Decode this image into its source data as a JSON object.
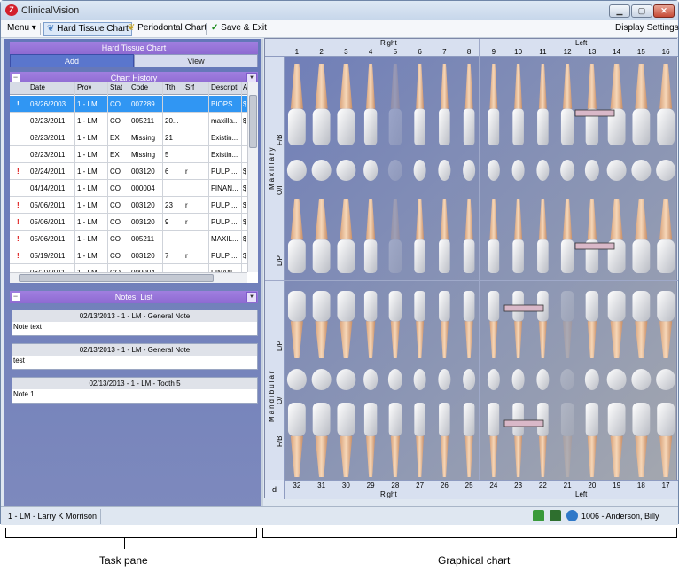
{
  "window": {
    "title": "ClinicalVision"
  },
  "toolbar": {
    "menu": "Menu",
    "hard_tissue": "Hard Tissue Chart",
    "periodontal": "Periodontal Chart",
    "save_exit": "Save & Exit",
    "display_settings": "Display Settings"
  },
  "taskpane": {
    "header": "Hard Tissue Chart",
    "add": "Add",
    "view": "View",
    "history_header": "Chart History",
    "columns": [
      "Date",
      "Prov",
      "Stat",
      "Code",
      "Tth",
      "Srf",
      "Descripti",
      "A"
    ],
    "rows": [
      {
        "flag": "!",
        "date": "08/26/2003",
        "prov": "1 - LM",
        "stat": "CO",
        "code": "007289",
        "tth": "",
        "srf": "",
        "desc": "BIOPS...",
        "a": "$"
      },
      {
        "flag": "",
        "date": "02/23/2011",
        "prov": "1 - LM",
        "stat": "CO",
        "code": "005211",
        "tth": "20...",
        "srf": "",
        "desc": "maxilla...",
        "a": "$"
      },
      {
        "flag": "",
        "date": "02/23/2011",
        "prov": "1 - LM",
        "stat": "EX",
        "code": "Missing",
        "tth": "21",
        "srf": "",
        "desc": "Existin...",
        "a": ""
      },
      {
        "flag": "",
        "date": "02/23/2011",
        "prov": "1 - LM",
        "stat": "EX",
        "code": "Missing",
        "tth": "5",
        "srf": "",
        "desc": "Existin...",
        "a": ""
      },
      {
        "flag": "!",
        "date": "02/24/2011",
        "prov": "1 - LM",
        "stat": "CO",
        "code": "003120",
        "tth": "6",
        "srf": "r",
        "desc": "PULP ...",
        "a": "$"
      },
      {
        "flag": "",
        "date": "04/14/2011",
        "prov": "1 - LM",
        "stat": "CO",
        "code": "000004",
        "tth": "",
        "srf": "",
        "desc": "FINAN...",
        "a": "$"
      },
      {
        "flag": "!",
        "date": "05/06/2011",
        "prov": "1 - LM",
        "stat": "CO",
        "code": "003120",
        "tth": "23",
        "srf": "r",
        "desc": "PULP ...",
        "a": "$"
      },
      {
        "flag": "!",
        "date": "05/06/2011",
        "prov": "1 - LM",
        "stat": "CO",
        "code": "003120",
        "tth": "9",
        "srf": "r",
        "desc": "PULP ...",
        "a": "$"
      },
      {
        "flag": "!",
        "date": "05/06/2011",
        "prov": "1 - LM",
        "stat": "CO",
        "code": "005211",
        "tth": "",
        "srf": "",
        "desc": "MAXIL...",
        "a": "$"
      },
      {
        "flag": "!",
        "date": "05/19/2011",
        "prov": "1 - LM",
        "stat": "CO",
        "code": "003120",
        "tth": "7",
        "srf": "r",
        "desc": "PULP ...",
        "a": "$"
      },
      {
        "flag": "",
        "date": "06/20/2011",
        "prov": "1 - LM",
        "stat": "CO",
        "code": "000004",
        "tth": "",
        "srf": "",
        "desc": "FINAN...",
        "a": ""
      }
    ],
    "notes_header": "Notes: List",
    "notes": [
      {
        "title": "02/13/2013 - 1 - LM - General Note",
        "text": "Note text"
      },
      {
        "title": "02/13/2013 - 1 - LM - General Note",
        "text": "test"
      },
      {
        "title": "02/13/2013 - 1 - LM - Tooth 5",
        "text": "Note 1"
      }
    ]
  },
  "chart": {
    "right": "Right",
    "left": "Left",
    "upper_numbers": [
      "1",
      "2",
      "3",
      "4",
      "5",
      "6",
      "7",
      "8",
      "9",
      "10",
      "11",
      "12",
      "13",
      "14",
      "15",
      "16"
    ],
    "lower_numbers": [
      "32",
      "31",
      "30",
      "29",
      "28",
      "27",
      "26",
      "25",
      "24",
      "23",
      "22",
      "21",
      "20",
      "19",
      "18",
      "17"
    ],
    "maxillary": "Maxillary",
    "mandibular": "Mandibular",
    "row_fb": "F/B",
    "row_oi": "O/I",
    "row_lp": "L/P",
    "corner": "d"
  },
  "status": {
    "user": "1 - LM - Larry K Morrison",
    "patient": "1006 - Anderson, Billy"
  },
  "annotations": {
    "task_pane": "Task pane",
    "graphical_chart": "Graphical chart"
  }
}
